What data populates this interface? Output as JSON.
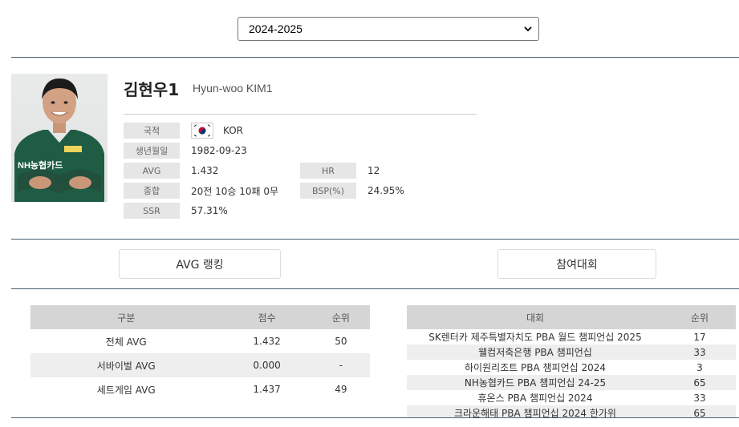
{
  "season_select": {
    "value": "2024-2025"
  },
  "player": {
    "name_ko": "김현우1",
    "name_en": "Hyun-woo KIM1",
    "fields": {
      "nationality": {
        "label": "국적",
        "value": "KOR"
      },
      "birthdate": {
        "label": "생년월일",
        "value": "1982-09-23"
      },
      "avg": {
        "label": "AVG",
        "value": "1.432"
      },
      "hr": {
        "label": "HR",
        "value": "12"
      },
      "total": {
        "label": "종합",
        "value": "20전 10승 10패 0무"
      },
      "bsp": {
        "label": "BSP(%)",
        "value": "24.95%"
      },
      "ssr": {
        "label": "SSR",
        "value": "57.31%"
      }
    },
    "jersey_text": "NH농협카드"
  },
  "tabs": {
    "avg_ranking": "AVG 랭킹",
    "tournaments": "참여대회"
  },
  "avg_table": {
    "headers": [
      "구분",
      "점수",
      "순위"
    ],
    "rows": [
      [
        "전체 AVG",
        "1.432",
        "50"
      ],
      [
        "서바이벌 AVG",
        "0.000",
        "-"
      ],
      [
        "세트게임 AVG",
        "1.437",
        "49"
      ]
    ]
  },
  "tournament_table": {
    "headers": [
      "대회",
      "순위"
    ],
    "rows": [
      [
        "SK렌터카 제주특별자치도 PBA 월드 챔피언십 2025",
        "17"
      ],
      [
        "웰컴저축은행 PBA 챔피언십",
        "33"
      ],
      [
        "하이원리조트 PBA 챔피언십 2024",
        "3"
      ],
      [
        "NH농협카드 PBA 챔피언십 24-25",
        "65"
      ],
      [
        "휴온스 PBA 챔피언십 2024",
        "33"
      ],
      [
        "크라운해태 PBA 챔피언십 2024 한가위",
        "65"
      ]
    ]
  },
  "colors": {
    "rule": "#4c5d6e",
    "header_bg": "#d5d5d5",
    "label_bg": "#e6e6e6",
    "jersey": "#1f5c44"
  }
}
